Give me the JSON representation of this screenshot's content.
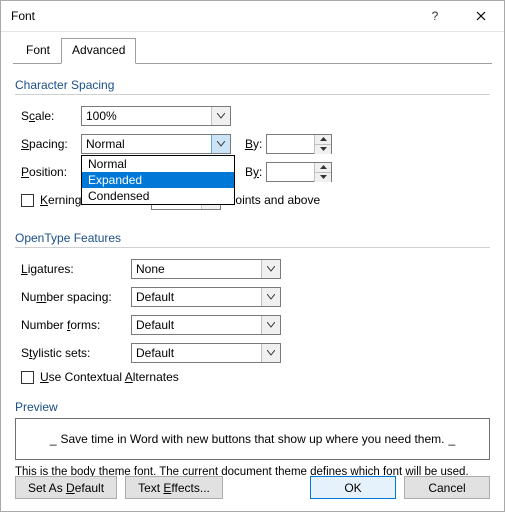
{
  "title": "Font",
  "tabs": {
    "font": "Font",
    "advanced": "Advanced"
  },
  "group1": {
    "title": "Character Spacing",
    "scale_label": "Scale:",
    "scale_value": "100%",
    "spacing_label": "Spacing:",
    "spacing_value": "Normal",
    "spacing_options": [
      "Normal",
      "Expanded",
      "Condensed"
    ],
    "spacing_selected_index": 1,
    "position_label": "Position:",
    "by_label": "By:",
    "kerning_label": "Kerning for fonts:",
    "points_label": "Points and above"
  },
  "group2": {
    "title": "OpenType Features",
    "ligatures_label": "Ligatures:",
    "ligatures_value": "None",
    "numspacing_label": "Number spacing:",
    "numspacing_value": "Default",
    "numforms_label": "Number forms:",
    "numforms_value": "Default",
    "stylistic_label": "Stylistic sets:",
    "stylistic_value": "Default",
    "contextual_label": "Use Contextual Alternates"
  },
  "preview": {
    "title": "Preview",
    "text": "Save time in Word with new buttons that show up where you need them.",
    "note": "This is the body theme font. The current document theme defines which font will be used."
  },
  "footer": {
    "set_default": "Set As Default",
    "text_effects": "Text Effects...",
    "ok": "OK",
    "cancel": "Cancel"
  }
}
